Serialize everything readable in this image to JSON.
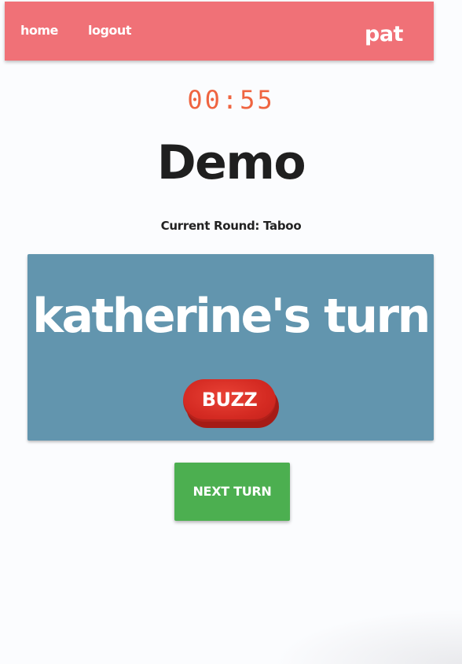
{
  "navbar": {
    "home_label": "home",
    "logout_label": "logout",
    "username": "pat",
    "color": "#f07177"
  },
  "game": {
    "timer": "00:55",
    "title": "Demo",
    "current_round": "Current Round: Taboo",
    "turn_text": "katherine's turn",
    "buzz_label": "BUZZ",
    "next_turn_label": "NEXT TURN"
  },
  "colors": {
    "card": "#6295ae",
    "buzz": "#d42a22",
    "next_button": "#4caf50",
    "timer": "#ef6440"
  }
}
